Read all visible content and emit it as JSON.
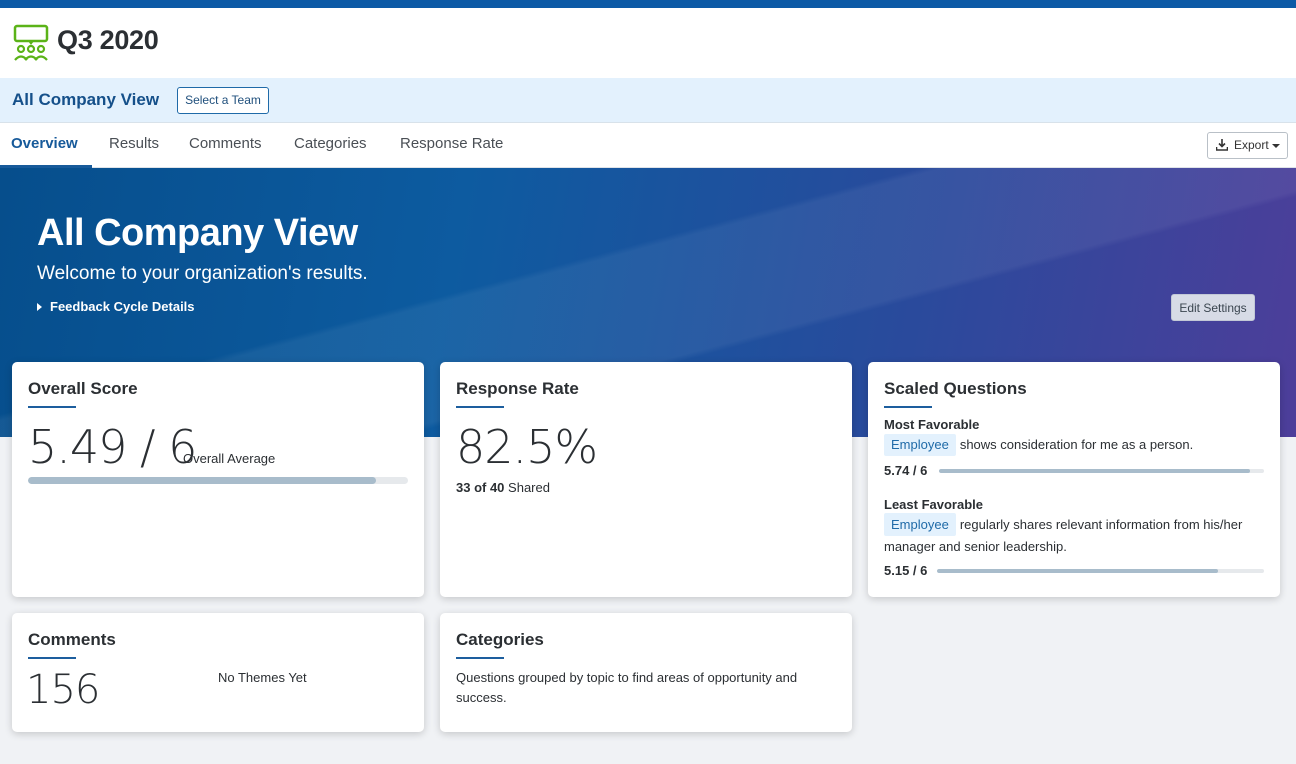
{
  "header": {
    "title": "Q3 2020",
    "logo_icon": "people-chat-icon",
    "accent": "#0c5aa6",
    "logo_color": "#5bb318"
  },
  "team_bar": {
    "view_name": "All Company View",
    "select_team_label": "Select a Team"
  },
  "nav": {
    "tabs": [
      {
        "label": "Overview",
        "active": true
      },
      {
        "label": "Results"
      },
      {
        "label": "Comments"
      },
      {
        "label": "Categories"
      },
      {
        "label": "Response Rate"
      }
    ],
    "export_label": "Export",
    "export_icon": "download-icon"
  },
  "hero": {
    "title": "All Company View",
    "subtitle": "Welcome to your organization's results.",
    "details_toggle": "Feedback Cycle Details",
    "edit_settings_label": "Edit Settings"
  },
  "overall_score": {
    "title": "Overall Score",
    "score": "5.49 / 6",
    "caption": "Overall Average",
    "fraction": 0.915
  },
  "response_rate": {
    "title": "Response Rate",
    "value": "82.5%",
    "shared_count": "33 of 40",
    "shared_label": "Shared"
  },
  "scaled_questions": {
    "title": "Scaled Questions",
    "most": {
      "heading": "Most Favorable",
      "tag": "Employee",
      "text": "shows consideration for me as a person.",
      "score": "5.74 / 6",
      "fraction": 0.957
    },
    "least": {
      "heading": "Least Favorable",
      "tag": "Employee",
      "text": "regularly shares relevant information from his/her manager and senior leadership.",
      "score": "5.15 / 6",
      "fraction": 0.858
    }
  },
  "comments": {
    "title": "Comments",
    "count": "156",
    "themes_text": "No Themes Yet"
  },
  "categories": {
    "title": "Categories",
    "description": "Questions grouped by topic to find areas of opportunity and success."
  }
}
